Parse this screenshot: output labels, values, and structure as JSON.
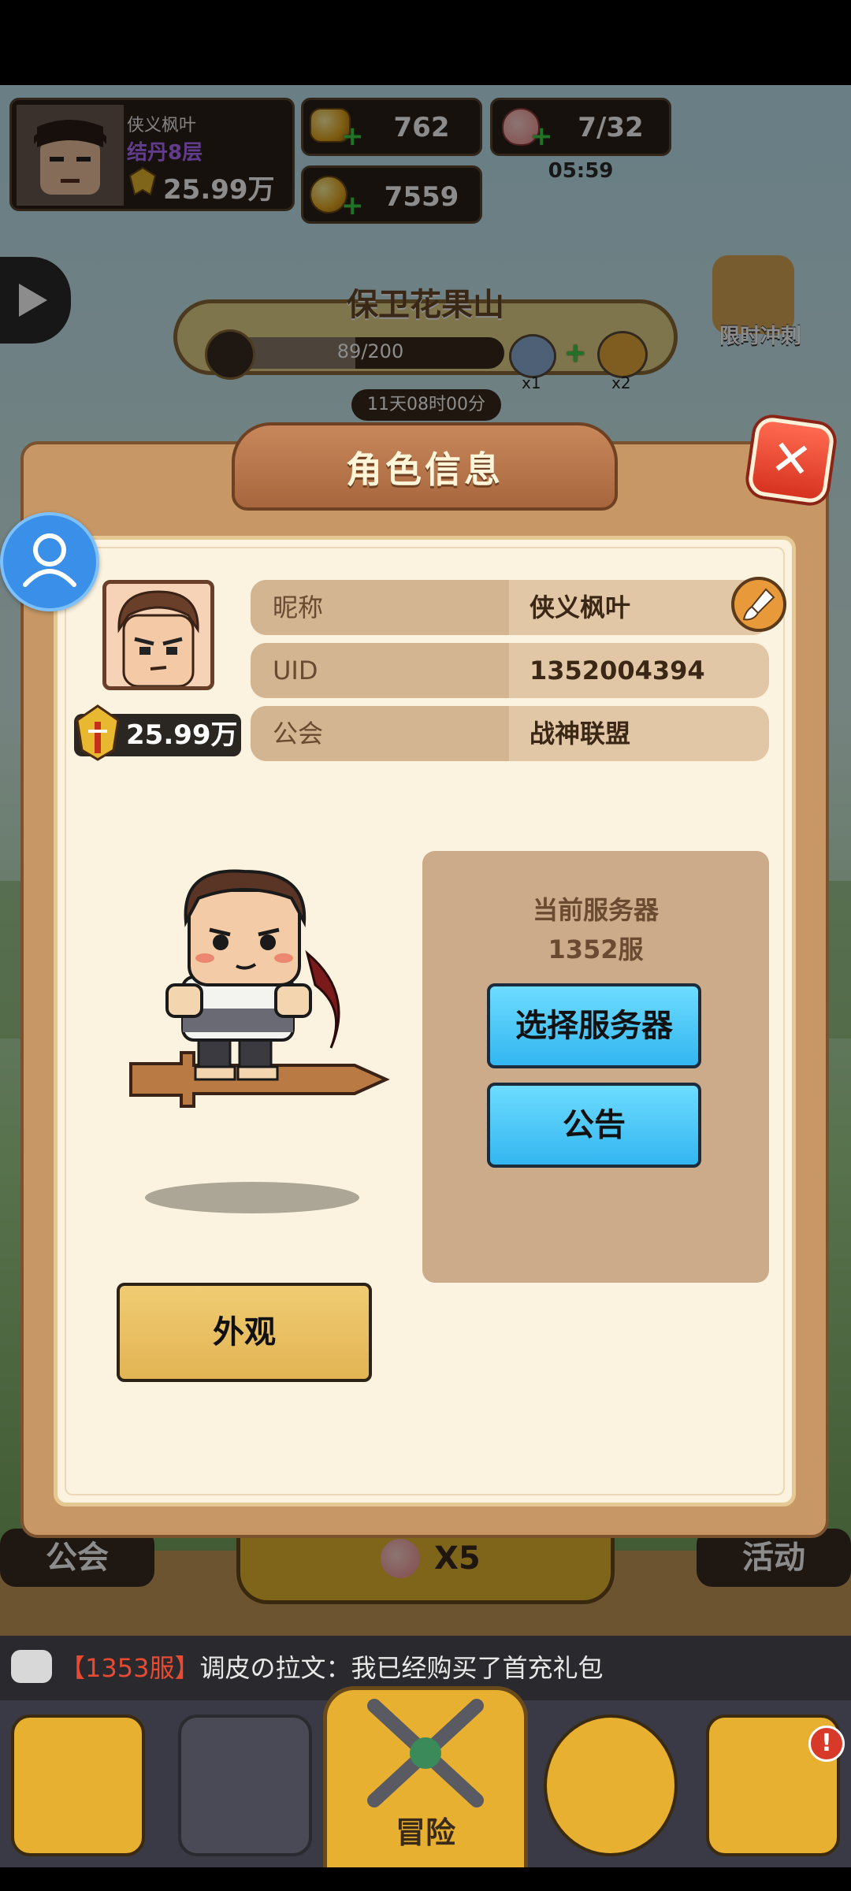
{
  "hud": {
    "player_name": "侠义枫叶",
    "realm": "结丹8层",
    "power": "25.99万",
    "gold": "762",
    "coins": "7559",
    "stamina": "7/32",
    "stamina_timer": "05:59"
  },
  "event": {
    "title": "保卫花果山",
    "progress_text": "89/200",
    "progress_fraction": 0.445,
    "reward1_mult": "x1",
    "reward2_mult": "x2",
    "countdown": "11天08时00分",
    "limited_label": "限时冲刺"
  },
  "dialog": {
    "title": "角色信息",
    "power": "25.99万",
    "rows": [
      {
        "label": "昵称",
        "value": "侠义枫叶"
      },
      {
        "label": "UID",
        "value": "1352004394"
      },
      {
        "label": "公会",
        "value": "战神联盟"
      }
    ],
    "server_label": "当前服务器",
    "server_value": "1352服",
    "select_server_button": "选择服务器",
    "notice_button": "公告",
    "appearance_button": "外观"
  },
  "behind": {
    "guild_label": "公会",
    "peach_mult": "X5",
    "activity_label": "活动"
  },
  "chat": {
    "server_tag": "【1353服】",
    "message": "调皮の拉文：我已经购买了首充礼包"
  },
  "nav": {
    "adventure_label": "冒险"
  },
  "colors": {
    "panel": "#c79866",
    "panel_inner": "#fbf3df",
    "blue_button": "#45c6f6",
    "yellow_button": "#e9c064",
    "close_button": "#e84a32"
  }
}
